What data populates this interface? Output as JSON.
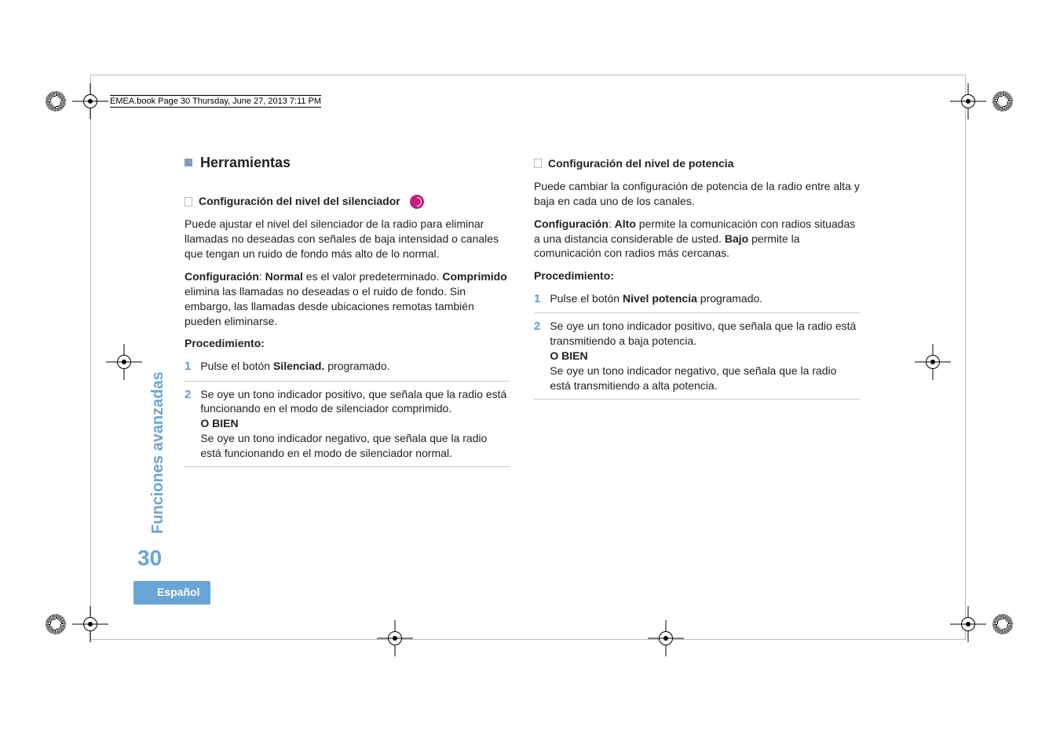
{
  "book_header": "EMEA.book  Page 30  Thursday, June 27, 2013  7:11 PM",
  "side_tab": "Funciones avanzadas",
  "page_number": "30",
  "language": "Español",
  "left": {
    "tools_heading": "Herramientas",
    "squelch": {
      "heading": "Configuración del nivel del silenciador",
      "p1": "Puede ajustar el nivel del silenciador de la radio para eliminar llamadas no deseadas con señales de baja intensidad o canales que tengan un ruido de fondo más alto de lo normal.",
      "p2_pre": "Configuración",
      "p2_sep": ": ",
      "p2_b1": "Normal",
      "p2_mid": " es el valor predeterminado. ",
      "p2_b2": "Comprimido",
      "p2_end": " elimina las llamadas no deseadas o el ruido de fondo. Sin embargo, las llamadas desde ubicaciones remotas también pueden eliminarse.",
      "proc_label": "Procedimiento",
      "proc_colon": ":",
      "step1_pre": "Pulse el botón ",
      "step1_b": "Silenciad.",
      "step1_end": " programado.",
      "step2_a": "Se oye un tono indicador positivo, que señala que la radio está funcionando en el modo de silenciador comprimido.",
      "step2_or": "O BIEN",
      "step2_b": "Se oye un tono indicador negativo, que señala que la radio está funcionando en el modo de silenciador normal."
    }
  },
  "right": {
    "power": {
      "heading": "Configuración del nivel de potencia",
      "p1": "Puede cambiar la configuración de potencia de la radio entre alta y baja en cada uno de los canales.",
      "p2_pre": "Configuración",
      "p2_sep": ":  ",
      "p2_b1": "Alto",
      "p2_mid": " permite la comunicación con radios situadas a una distancia considerable de usted. ",
      "p2_b2": "Bajo",
      "p2_end": " permite la comunicación con radios más cercanas.",
      "proc_label": "Procedimiento",
      "proc_colon": ":",
      "step1_pre": "Pulse el botón ",
      "step1_b": "Nivel potencia",
      "step1_end": " programado.",
      "step2_a": "Se oye un tono indicador positivo, que señala que la radio está transmitiendo a baja potencia.",
      "step2_or": "O BIEN",
      "step2_b": "Se oye un tono indicador negativo, que señala que la radio está transmitiendo a alta potencia."
    }
  }
}
